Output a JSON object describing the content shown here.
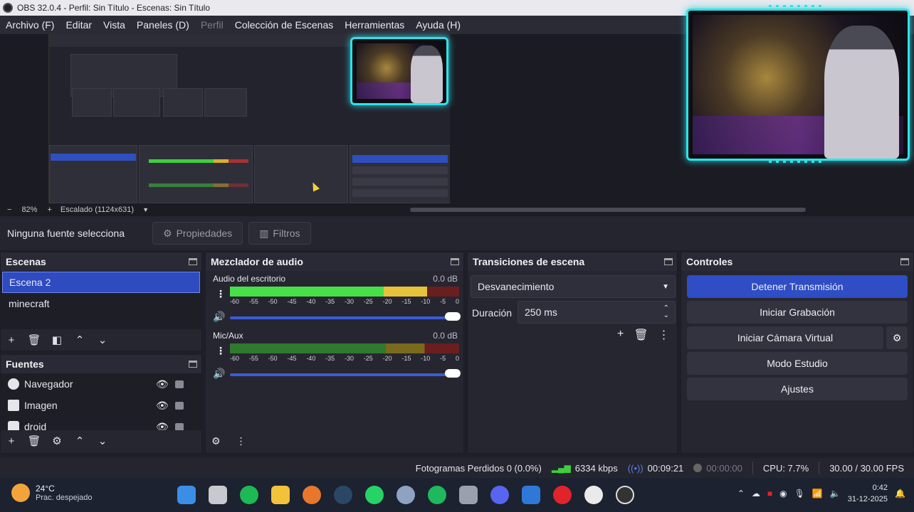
{
  "window": {
    "title": "OBS 32.0.4 - Perfil: Sin Título - Escenas: Sin Título"
  },
  "menu": {
    "items": [
      "Archivo (F)",
      "Editar",
      "Vista",
      "Paneles (D)",
      "Perfil",
      "Colección de Escenas",
      "Herramientas",
      "Ayuda (H)"
    ]
  },
  "preview": {
    "zoom": "82%",
    "scale_label": "Escalado (1124x631)",
    "zoom_minus": "−",
    "zoom_plus": "+"
  },
  "context_bar": {
    "no_source": "Ninguna fuente selecciona",
    "properties": "Propiedades",
    "filters": "Filtros"
  },
  "scenes": {
    "title": "Escenas",
    "items": [
      "Escena 2",
      "minecraft"
    ],
    "selected": "Escena 2"
  },
  "sources": {
    "title": "Fuentes",
    "items": [
      "Navegador",
      "Imagen",
      "droid"
    ]
  },
  "mixer": {
    "title": "Mezclador de audio",
    "channels": [
      {
        "name": "Audio del escritorio",
        "db": "0.0 dB",
        "level": 0.86
      },
      {
        "name": "Mic/Aux",
        "db": "0.0 dB",
        "level": 0.0
      }
    ],
    "ticks": [
      "-60",
      "-55",
      "-50",
      "-45",
      "-40",
      "-35",
      "-30",
      "-25",
      "-20",
      "-15",
      "-10",
      "-5",
      "0"
    ]
  },
  "transitions": {
    "title": "Transiciones de escena",
    "selected": "Desvanecimiento",
    "duration_label": "Duración",
    "duration_value": "250 ms"
  },
  "controls": {
    "title": "Controles",
    "buttons": [
      "Detener Transmisión",
      "Iniciar Grabación",
      "Iniciar Cámara Virtual",
      "Modo Estudio",
      "Ajustes"
    ]
  },
  "status": {
    "dropped_frames": "Fotogramas Perdidos 0 (0.0%)",
    "bitrate": "6334 kbps",
    "stream_time": "00:09:21",
    "rec_time": "00:00:00",
    "cpu": "CPU: 7.7%",
    "fps": "30.00 / 30.00 FPS"
  },
  "taskbar": {
    "temperature": "24°C",
    "weather": "Prac. despejado",
    "time": "0:42",
    "date": "31-12-2025"
  },
  "colors": {
    "accent": "#2f4dc4",
    "neon_frame": "#2ee2e8",
    "background": "#262631"
  }
}
